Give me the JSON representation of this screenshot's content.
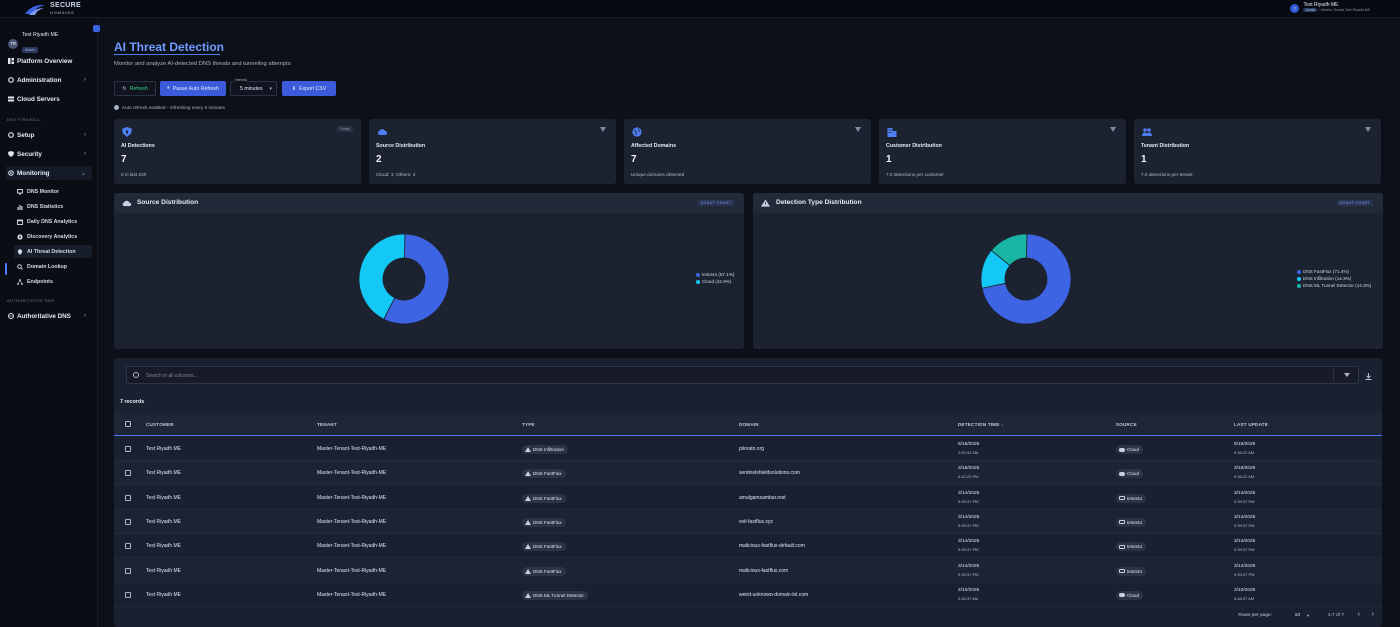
{
  "app": {
    "logo_name": "SECURE",
    "logo_sub": "DOMAINS",
    "top_user_initials": "T",
    "top_user_name": "Test Riyadh ME",
    "top_user_role": "Admin",
    "top_user_tenant": "• Master-Tenant-Test-Riyadh-ME"
  },
  "sidebar": {
    "user_initials": "TR",
    "user_name": "Test Riyadh ME",
    "user_badge": "Admin",
    "platform_overview": "Platform Overview",
    "administration": "Administration",
    "cloud_servers": "Cloud Servers",
    "section_dns_firewall": "DNS FIREWALL",
    "setup": "Setup",
    "security": "Security",
    "monitoring": "Monitoring",
    "sub_items": [
      "DNS Monitor",
      "DNS Statistics",
      "Daily DNS Analytics",
      "Discovery Analytics",
      "AI Threat Detection",
      "Domain Lookup",
      "Endpoints"
    ],
    "section_authoritative": "AUTHORITATIVE DNS",
    "authoritative_dns": "Authoritative DNS"
  },
  "page": {
    "title": "AI Threat Detection",
    "subtitle": "Monitor and analyze AI-detected DNS threats and tunneling attempts",
    "refresh_label": "Refresh",
    "pause_label": "Pause Auto Refresh",
    "interval_label": "Interval",
    "interval_value": "5 minutes",
    "export_label": "Export CSV",
    "auto_note": "Auto refresh enabled - refreshing every 5 minutes"
  },
  "cards": [
    {
      "title": "AI Detections",
      "value": "7",
      "sub": "0 in last 24h",
      "tag": "Today"
    },
    {
      "title": "Source Distribution",
      "value": "2",
      "sub": "Cloud: 3, Others: 4"
    },
    {
      "title": "Affected Domains",
      "value": "7",
      "sub": "Unique domains detected"
    },
    {
      "title": "Customer Distribution",
      "value": "1",
      "sub": "7.0 detections per customer"
    },
    {
      "title": "Tenant Distribution",
      "value": "1",
      "sub": "7.0 detections per tenant"
    }
  ],
  "panels": {
    "source": {
      "title": "Source Distribution",
      "tag": "DONUT CHART"
    },
    "detection": {
      "title": "Detection Type Distribution",
      "tag": "DONUT CHART"
    }
  },
  "chart_data": [
    {
      "type": "pie",
      "title": "Source Distribution",
      "categories": [
        "test444",
        "Cloud"
      ],
      "values": [
        57.1,
        42.9
      ],
      "legend": [
        "test444 (57.1%)",
        "Cloud (42.9%)"
      ],
      "colors": [
        "#3d64e3",
        "#14c8f5"
      ],
      "legend_position": "right"
    },
    {
      "type": "pie",
      "title": "Detection Type Distribution",
      "categories": [
        "DNS FastFlux",
        "DNS Infiltration",
        "DNS ML Tunnel Detector"
      ],
      "values": [
        71.4,
        14.3,
        14.3
      ],
      "legend": [
        "DNS FastFlux (71.4%)",
        "DNS Infiltration (14.3%)",
        "DNS ML Tunnel Detector (14.3%)"
      ],
      "colors": [
        "#3d64e3",
        "#14c8f5",
        "#18b4a4"
      ],
      "legend_position": "right"
    }
  ],
  "table": {
    "search_placeholder": "Search in all columns...",
    "records": "7 records",
    "headers": [
      "CUSTOMER",
      "TENANT",
      "TYPE",
      "DOMAIN",
      "DETECTION TIME",
      "SOURCE",
      "LAST UPDATE"
    ],
    "sort_arrow": "↓",
    "rows": [
      {
        "customer": "Test Riyadh ME",
        "tenant": "Master-Tenant-Test-Riyadh-ME",
        "type": "DNS Infiltration",
        "domain": "piiorato.org",
        "det_date": "5/16/2026",
        "det_time": "2:52:42 AM",
        "source": "Cloud",
        "source_icon": "cloud",
        "upd_date": "5/16/2026",
        "upd_time": "9:36:22 AM"
      },
      {
        "customer": "Test Riyadh ME",
        "tenant": "Master-Tenant-Test-Riyadh-ME",
        "type": "DNS FastFlux",
        "domain": "sentinelshieldsolutions.com",
        "det_date": "3/18/2026",
        "det_time": "6:42:22 PM",
        "source": "Cloud",
        "source_icon": "cloud",
        "upd_date": "3/18/2026",
        "upd_time": "9:36:22 AM"
      },
      {
        "customer": "Test Riyadh ME",
        "tenant": "Master-Tenant-Test-Riyadh-ME",
        "type": "DNS FastFlux",
        "domain": "amalgamsambar.rest",
        "det_date": "3/14/2026",
        "det_time": "9:39:37 PM",
        "source": "test444",
        "source_icon": "pc",
        "upd_date": "3/14/2026",
        "upd_time": "9:39:37 PM"
      },
      {
        "customer": "Test Riyadh ME",
        "tenant": "Master-Tenant-Test-Riyadh-ME",
        "type": "DNS FastFlux",
        "domain": "evil-fastflux.xyz",
        "det_date": "3/14/2026",
        "det_time": "9:39:37 PM",
        "source": "test444",
        "source_icon": "pc",
        "upd_date": "3/14/2026",
        "upd_time": "9:39:37 PM"
      },
      {
        "customer": "Test Riyadh ME",
        "tenant": "Master-Tenant-Test-Riyadh-ME",
        "type": "DNS FastFlux",
        "domain": "malicious-fastflux-default.com",
        "det_date": "3/14/2026",
        "det_time": "9:39:37 PM",
        "source": "test444",
        "source_icon": "pc",
        "upd_date": "3/14/2026",
        "upd_time": "9:39:37 PM"
      },
      {
        "customer": "Test Riyadh ME",
        "tenant": "Master-Tenant-Test-Riyadh-ME",
        "type": "DNS FastFlux",
        "domain": "malicious-fastflux.com",
        "det_date": "3/14/2026",
        "det_time": "9:39:37 PM",
        "source": "test444",
        "source_icon": "pc",
        "upd_date": "3/14/2026",
        "upd_time": "9:39:37 PM"
      },
      {
        "customer": "Test Riyadh ME",
        "tenant": "Master-Tenant-Test-Riyadh-ME",
        "type": "DNS ML Tunnel Detector",
        "domain": "weird-unknown-domain-lol.com",
        "det_date": "2/10/2026",
        "det_time": "4:48:37 AM",
        "source": "Cloud",
        "source_icon": "cloud",
        "upd_date": "2/10/2026",
        "upd_time": "5:48:37 AM"
      }
    ],
    "rows_per_page_label": "Rows per page:",
    "rows_per_page": "10",
    "range": "1-7 of 7"
  }
}
